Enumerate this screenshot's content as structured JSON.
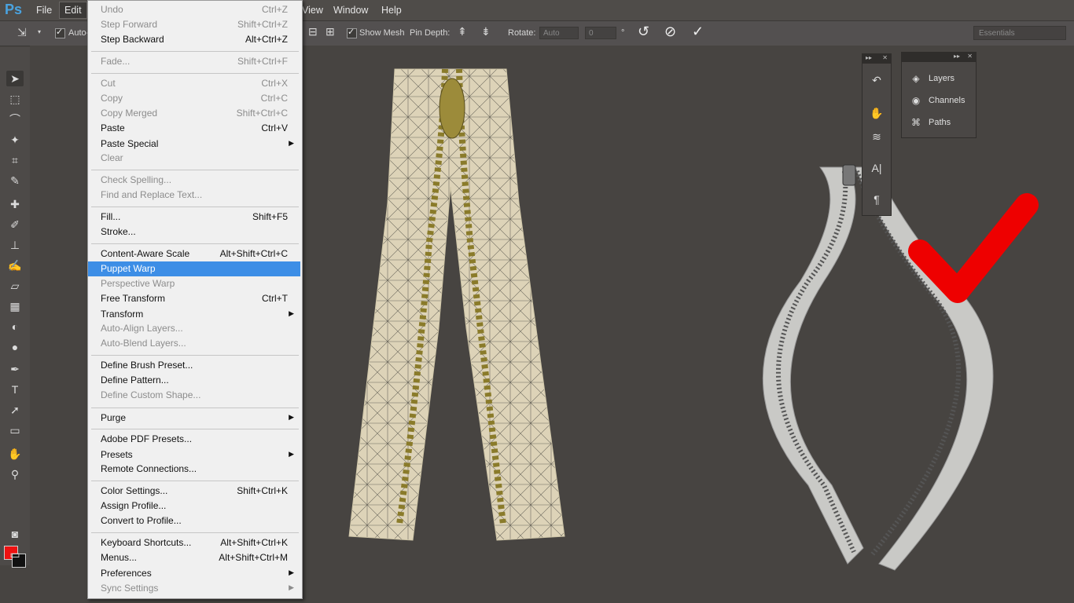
{
  "app": {
    "logo": "Ps"
  },
  "menubar": {
    "items": [
      "File",
      "Edit",
      "View",
      "Window",
      "Help"
    ]
  },
  "options": {
    "auto_label": "Auto-",
    "show_mesh": "Show Mesh",
    "pin_depth": "Pin Depth:",
    "rotate": "Rotate:",
    "rotate_mode": "Auto",
    "rotate_value": "0",
    "degree": "°",
    "workspace": "Essentials"
  },
  "edit_menu": {
    "items": [
      {
        "label": "Undo",
        "shortcut": "Ctrl+Z",
        "disabled": true
      },
      {
        "label": "Step Forward",
        "shortcut": "Shift+Ctrl+Z",
        "disabled": true
      },
      {
        "label": "Step Backward",
        "shortcut": "Alt+Ctrl+Z",
        "disabled": false
      },
      {
        "label": "Fade...",
        "shortcut": "Shift+Ctrl+F",
        "disabled": true
      },
      {
        "label": "Cut",
        "shortcut": "Ctrl+X",
        "disabled": true
      },
      {
        "label": "Copy",
        "shortcut": "Ctrl+C",
        "disabled": true
      },
      {
        "label": "Copy Merged",
        "shortcut": "Shift+Ctrl+C",
        "disabled": true
      },
      {
        "label": "Paste",
        "shortcut": "Ctrl+V",
        "disabled": false
      },
      {
        "label": "Paste Special",
        "shortcut": "",
        "disabled": false,
        "submenu": true
      },
      {
        "label": "Clear",
        "shortcut": "",
        "disabled": true
      },
      {
        "label": "Check Spelling...",
        "shortcut": "",
        "disabled": true
      },
      {
        "label": "Find and Replace Text...",
        "shortcut": "",
        "disabled": true
      },
      {
        "label": "Fill...",
        "shortcut": "Shift+F5",
        "disabled": false
      },
      {
        "label": "Stroke...",
        "shortcut": "",
        "disabled": false
      },
      {
        "label": "Content-Aware Scale",
        "shortcut": "Alt+Shift+Ctrl+C",
        "disabled": false
      },
      {
        "label": "Puppet Warp",
        "shortcut": "",
        "disabled": false,
        "highlighted": true
      },
      {
        "label": "Perspective Warp",
        "shortcut": "",
        "disabled": true
      },
      {
        "label": "Free Transform",
        "shortcut": "Ctrl+T",
        "disabled": false
      },
      {
        "label": "Transform",
        "shortcut": "",
        "disabled": false,
        "submenu": true
      },
      {
        "label": "Auto-Align Layers...",
        "shortcut": "",
        "disabled": true
      },
      {
        "label": "Auto-Blend Layers...",
        "shortcut": "",
        "disabled": true
      },
      {
        "label": "Define Brush Preset...",
        "shortcut": "",
        "disabled": false
      },
      {
        "label": "Define Pattern...",
        "shortcut": "",
        "disabled": false
      },
      {
        "label": "Define Custom Shape...",
        "shortcut": "",
        "disabled": true
      },
      {
        "label": "Purge",
        "shortcut": "",
        "disabled": false,
        "submenu": true
      },
      {
        "label": "Adobe PDF Presets...",
        "shortcut": "",
        "disabled": false
      },
      {
        "label": "Presets",
        "shortcut": "",
        "disabled": false,
        "submenu": true
      },
      {
        "label": "Remote Connections...",
        "shortcut": "",
        "disabled": false
      },
      {
        "label": "Color Settings...",
        "shortcut": "Shift+Ctrl+K",
        "disabled": false
      },
      {
        "label": "Assign Profile...",
        "shortcut": "",
        "disabled": false
      },
      {
        "label": "Convert to Profile...",
        "shortcut": "",
        "disabled": false
      },
      {
        "label": "Keyboard Shortcuts...",
        "shortcut": "Alt+Shift+Ctrl+K",
        "disabled": false
      },
      {
        "label": "Menus...",
        "shortcut": "Alt+Shift+Ctrl+M",
        "disabled": false
      },
      {
        "label": "Preferences",
        "shortcut": "",
        "disabled": false,
        "submenu": true
      },
      {
        "label": "Sync Settings",
        "shortcut": "",
        "disabled": true,
        "submenu": true
      }
    ]
  },
  "panels": {
    "right": [
      "Layers",
      "Channels",
      "Paths"
    ]
  },
  "colors": {
    "foreground": "#ee1111",
    "background": "#111111",
    "highlight": "#3d8ee6"
  }
}
